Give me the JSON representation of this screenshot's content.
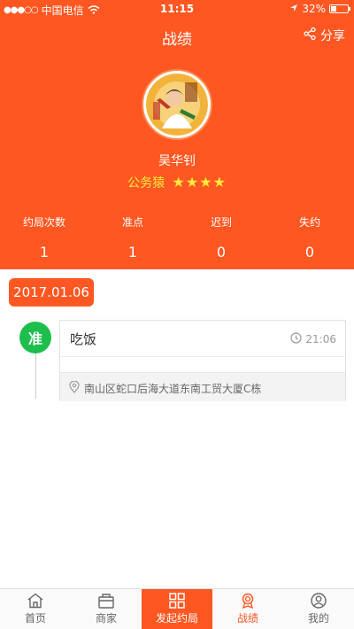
{
  "status_bar": {
    "carrier": "中国电信",
    "time": "11:15",
    "battery_percent": "32%",
    "battery_level": 0.32
  },
  "nav": {
    "title": "战绩",
    "share_label": "分享"
  },
  "profile": {
    "name": "吴华钊",
    "title": "公务猿",
    "stars": "★★★★",
    "star_count": 4
  },
  "stats": [
    {
      "label": "约局次数",
      "value": "1"
    },
    {
      "label": "准点",
      "value": "1"
    },
    {
      "label": "迟到",
      "value": "0"
    },
    {
      "label": "失约",
      "value": "0"
    }
  ],
  "timeline": {
    "date": "2017.01.06",
    "events": [
      {
        "status": "准",
        "name": "吃饭",
        "time": "21:06",
        "address": "南山区蛇口后海大道东南工贸大厦C栋"
      }
    ]
  },
  "tabbar": {
    "items": [
      {
        "label": "首页",
        "icon": "home-icon"
      },
      {
        "label": "商家",
        "icon": "store-icon"
      },
      {
        "label": "发起约局",
        "icon": "grid-icon"
      },
      {
        "label": "战绩",
        "icon": "medal-icon"
      },
      {
        "label": "我的",
        "icon": "user-icon"
      }
    ]
  },
  "colors": {
    "brand": "#FF5722",
    "ontime": "#1DBF4C",
    "stars": "#FFEB3B"
  }
}
